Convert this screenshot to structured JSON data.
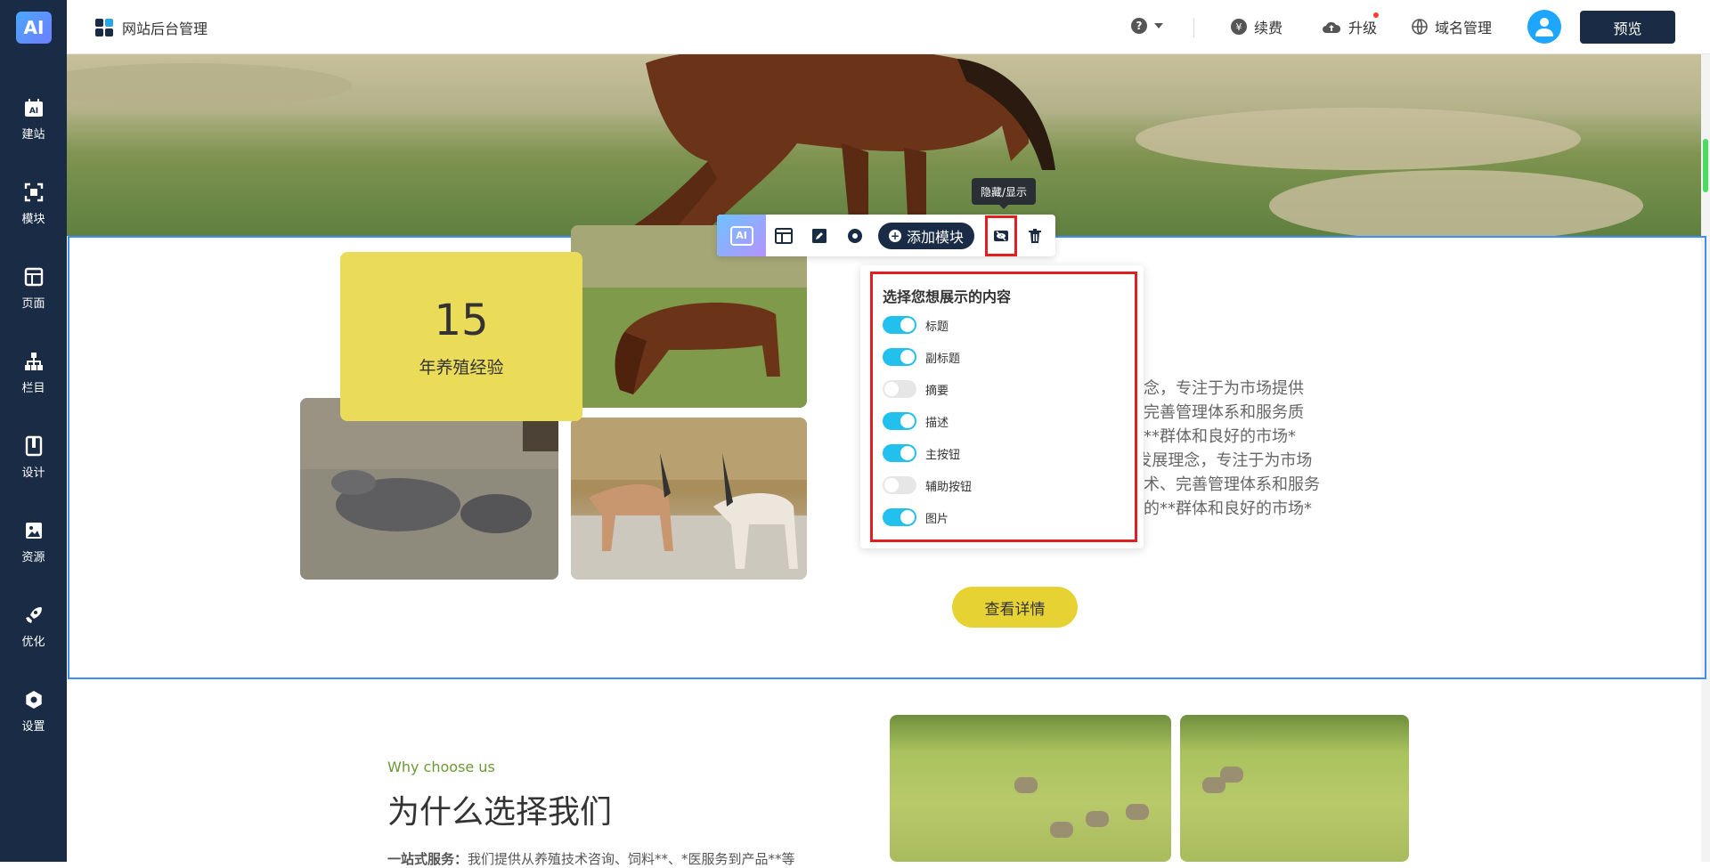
{
  "sidebar": {
    "logo": "AI",
    "items": [
      {
        "label": "建站",
        "icon": "ai-site-icon"
      },
      {
        "label": "模块",
        "icon": "module-icon"
      },
      {
        "label": "页面",
        "icon": "page-icon"
      },
      {
        "label": "栏目",
        "icon": "sitemap-icon"
      },
      {
        "label": "设计",
        "icon": "design-icon"
      },
      {
        "label": "资源",
        "icon": "resource-icon"
      },
      {
        "label": "优化",
        "icon": "rocket-icon"
      },
      {
        "label": "设置",
        "icon": "gear-icon"
      }
    ]
  },
  "topbar": {
    "title": "网站后台管理",
    "help": "?",
    "renew": "续费",
    "upgrade": "升级",
    "domain": "域名管理",
    "preview": "预览"
  },
  "toolbar": {
    "ai": "AI",
    "add_module": "添加模块",
    "tooltip": "隐藏/显示"
  },
  "section": {
    "years_number": "15",
    "years_text": "年养殖经验",
    "body_lines": [
      "的发展理念，专注于为市场提供",
      "殖技术、完善管理体系和服务质",
      "了稳定的**群体和良好的市场*",
      "持续”的发展理念，专注于为市场",
      "化养殖技术、完善管理体系和服务",
      "立了稳定的**群体和良好的市场*"
    ],
    "detail_button": "查看详情"
  },
  "popover": {
    "title": "选择您想展示的内容",
    "options": [
      {
        "label": "标题",
        "on": true
      },
      {
        "label": "副标题",
        "on": true
      },
      {
        "label": "摘要",
        "on": false
      },
      {
        "label": "描述",
        "on": true
      },
      {
        "label": "主按钮",
        "on": true
      },
      {
        "label": "辅助按钮",
        "on": false
      },
      {
        "label": "图片",
        "on": true
      }
    ]
  },
  "why": {
    "subtitle": "Why choose us",
    "title": "为什么选择我们",
    "desc_bold": "一站式服务：",
    "desc": "我们提供从养殖技术咨询、饲料**、*医服务到产品**等"
  },
  "colors": {
    "sidebar": "#1a2b45",
    "accent_blue": "#3d8ef7",
    "highlight_red": "#e02020",
    "toggle_on": "#22c0ec",
    "card_yellow": "#eadb58",
    "button_yellow": "#e7d234",
    "why_green": "#6a9a33"
  }
}
